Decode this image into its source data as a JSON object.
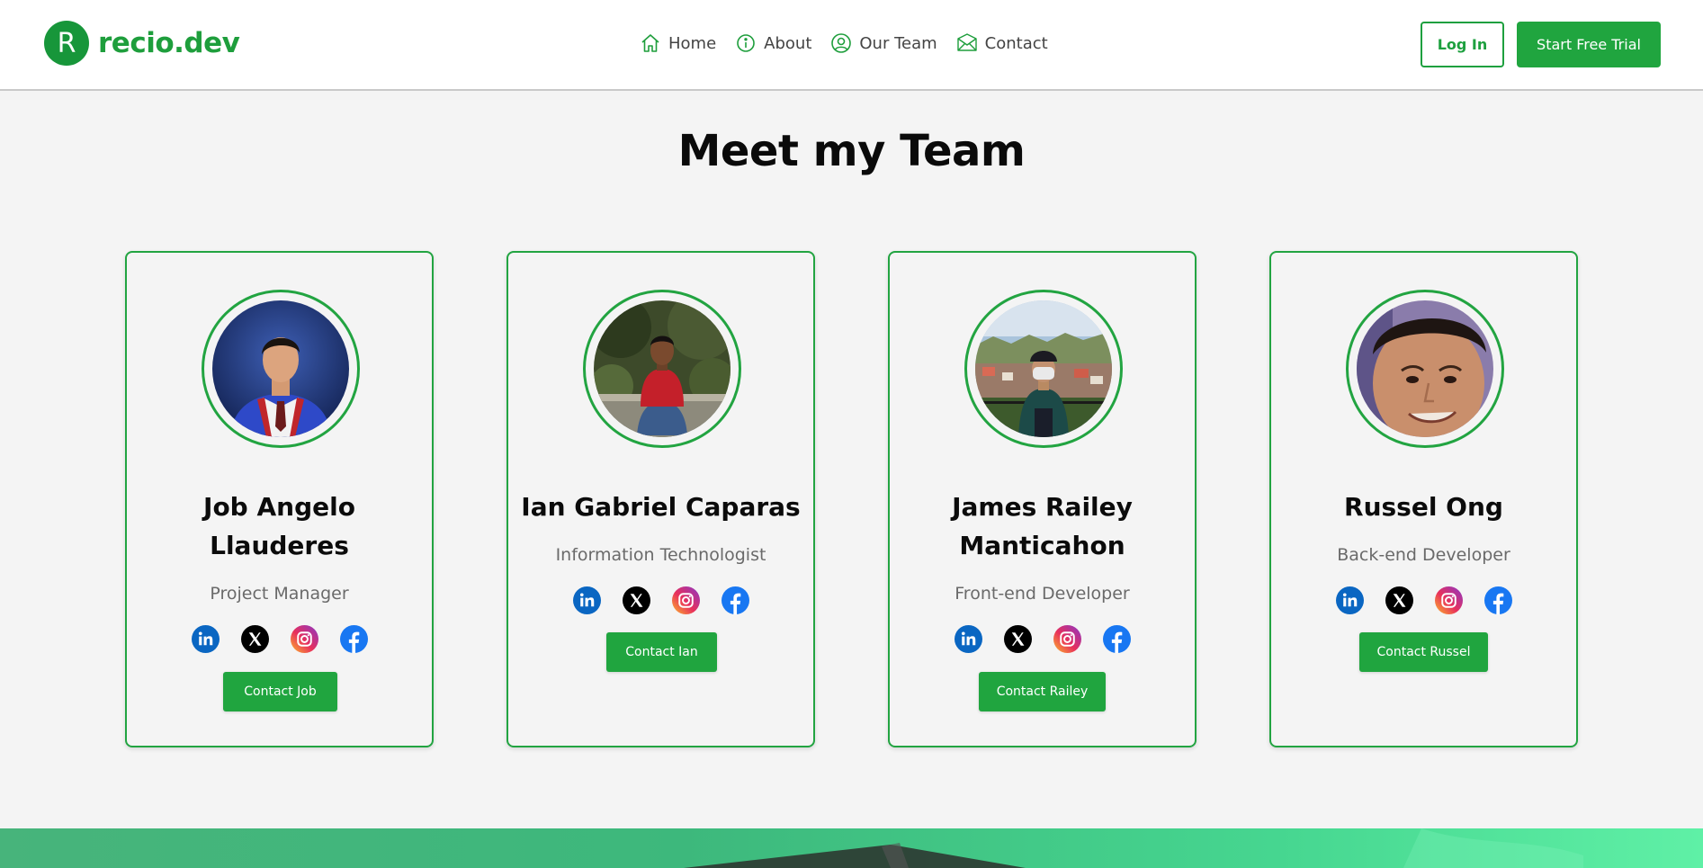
{
  "brand": {
    "initial": "R",
    "name": "recio.dev",
    "color": "#1e9e3c"
  },
  "nav": [
    {
      "label": "Home",
      "icon": "home-icon"
    },
    {
      "label": "About",
      "icon": "info-icon"
    },
    {
      "label": "Our Team",
      "icon": "user-circle-icon"
    },
    {
      "label": "Contact",
      "icon": "envelope-icon"
    }
  ],
  "header": {
    "login_label": "Log In",
    "trial_label": "Start Free Trial"
  },
  "section": {
    "title": "Meet my Team"
  },
  "team": [
    {
      "name": "Job Angelo Llauderes",
      "role": "Project Manager",
      "contact_label": "Contact Job"
    },
    {
      "name": "Ian Gabriel Caparas",
      "role": "Information Technologist",
      "contact_label": "Contact Ian"
    },
    {
      "name": "James Railey Manticahon",
      "role": "Front-end Developer",
      "contact_label": "Contact Railey"
    },
    {
      "name": "Russel Ong",
      "role": "Back-end Developer",
      "contact_label": "Contact Russel"
    }
  ],
  "socials": [
    "linkedin-icon",
    "x-icon",
    "instagram-icon",
    "facebook-icon"
  ],
  "colors": {
    "accent": "#20a53f",
    "linkedin": "#0a66c2",
    "facebook": "#1877f2",
    "x": "#000000"
  }
}
